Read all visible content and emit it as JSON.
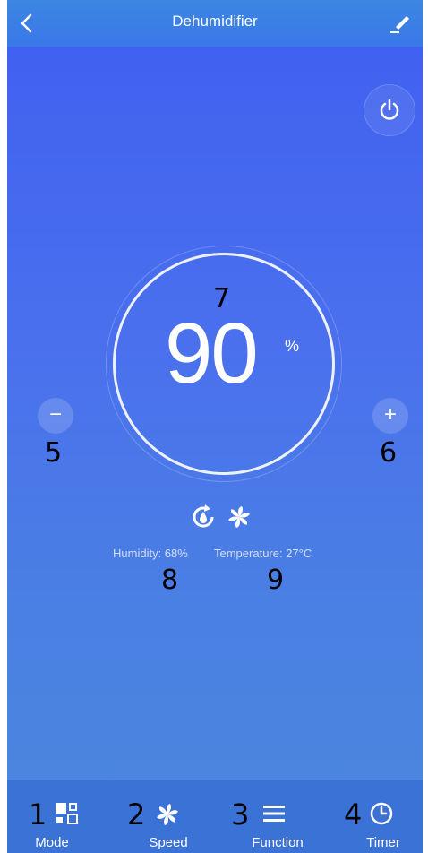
{
  "nav": {
    "title": "Dehumidifier"
  },
  "setpoint": {
    "value": "90",
    "unit": "%"
  },
  "controls": {
    "minus_label": "−",
    "plus_label": "+"
  },
  "status": {
    "humidity": "Humidity: 68%",
    "temperature": "Temperature: 27°C"
  },
  "annotations": {
    "a1": "1",
    "a2": "2",
    "a3": "3",
    "a4": "4",
    "a5": "5",
    "a6": "6",
    "a7": "7",
    "a8": "8",
    "a9": "9"
  },
  "tabs": [
    {
      "label": "Mode",
      "icon": "mode-icon"
    },
    {
      "label": "Speed",
      "icon": "fan-icon"
    },
    {
      "label": "Function",
      "icon": "menu-icon"
    },
    {
      "label": "Timer",
      "icon": "clock-icon"
    }
  ],
  "colors": {
    "accent": "#3a72d6",
    "background_top": "#3f5ff0",
    "background_bottom": "#4b88dd"
  }
}
